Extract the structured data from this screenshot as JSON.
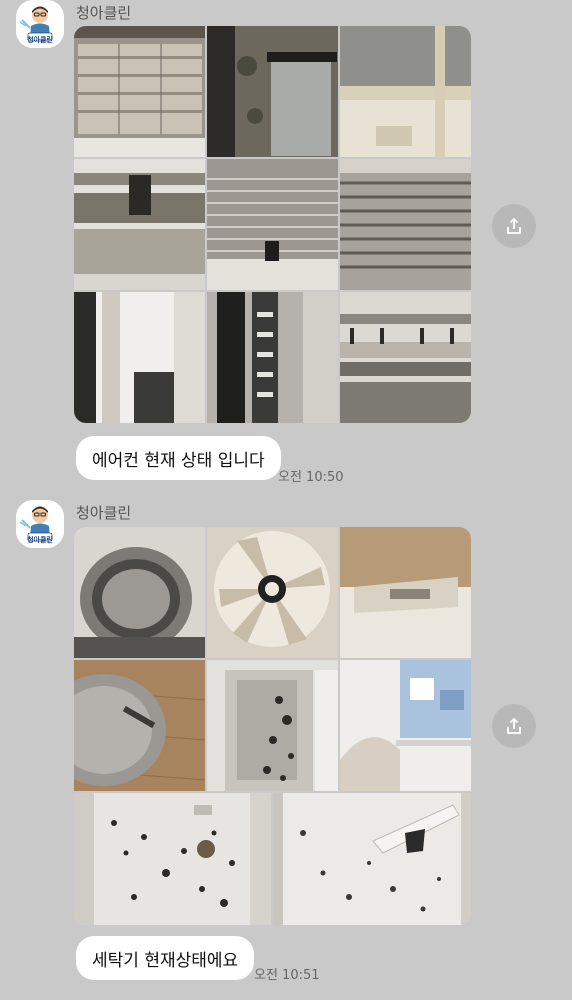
{
  "messages": [
    {
      "sender": "청아클린",
      "avatar_label": "청아클린",
      "photo_count": 9,
      "photo_subjects": [
        "air-conditioner-filter",
        "air-conditioner-frame",
        "air-conditioner-panel",
        "air-conditioner-fins",
        "air-conditioner-coil",
        "air-conditioner-coil-close",
        "air-conditioner-fan",
        "air-conditioner-blower",
        "air-conditioner-housing"
      ],
      "text": "에어컨 현재 상태 입니다",
      "time": "오전 10:50"
    },
    {
      "sender": "청아클린",
      "avatar_label": "청아클린",
      "photo_count": 8,
      "photo_subjects": [
        "washer-drum",
        "washer-pulsator",
        "washer-inner-panel",
        "washer-tub",
        "washer-detergent-box-mold",
        "washer-detergent-tray",
        "washer-panel-mold",
        "washer-panel-mold-2"
      ],
      "text": "세탁기 현재상태에요",
      "time": "오전 10:51"
    }
  ],
  "icons": {
    "share": "share-icon",
    "avatar": "cleaner-mascot-icon"
  },
  "colors": {
    "background": "#c9c9c9",
    "bubble": "#ffffff",
    "share_button": "#b8b8b8"
  }
}
